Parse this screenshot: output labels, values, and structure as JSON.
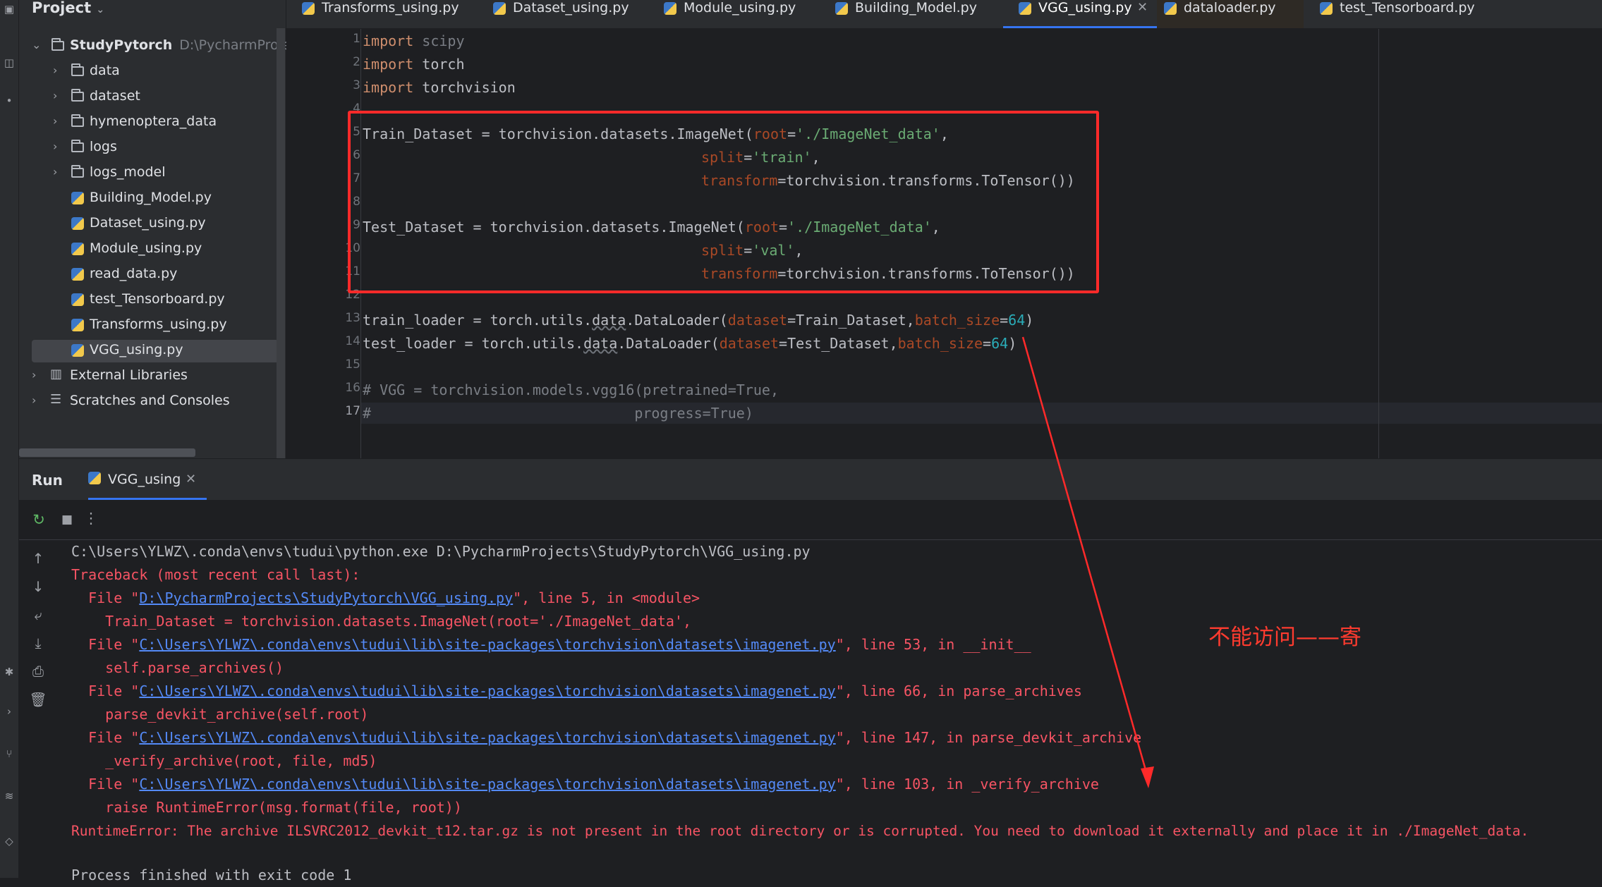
{
  "project": {
    "title": "Project",
    "tree": [
      {
        "label": "StudyPytorch",
        "path": "D:\\PycharmProjects",
        "kind": "folder",
        "level": 0,
        "expanded": true
      },
      {
        "label": "data",
        "kind": "folder",
        "level": 1
      },
      {
        "label": "dataset",
        "kind": "folder",
        "level": 1
      },
      {
        "label": "hymenoptera_data",
        "kind": "folder",
        "level": 1
      },
      {
        "label": "logs",
        "kind": "folder",
        "level": 1
      },
      {
        "label": "logs_model",
        "kind": "folder",
        "level": 1
      },
      {
        "label": "Building_Model.py",
        "kind": "python",
        "level": 1
      },
      {
        "label": "Dataset_using.py",
        "kind": "python",
        "level": 1
      },
      {
        "label": "Module_using.py",
        "kind": "python",
        "level": 1
      },
      {
        "label": "read_data.py",
        "kind": "python",
        "level": 1
      },
      {
        "label": "test_Tensorboard.py",
        "kind": "python",
        "level": 1
      },
      {
        "label": "Transforms_using.py",
        "kind": "python",
        "level": 1
      },
      {
        "label": "VGG_using.py",
        "kind": "python",
        "level": 1,
        "selected": true
      },
      {
        "label": "External Libraries",
        "kind": "library",
        "level": 0
      },
      {
        "label": "Scratches and Consoles",
        "kind": "scratch",
        "level": 0
      }
    ]
  },
  "tabs": [
    {
      "label": "Transforms_using.py"
    },
    {
      "label": "Dataset_using.py"
    },
    {
      "label": "Module_using.py"
    },
    {
      "label": "Building_Model.py"
    },
    {
      "label": "VGG_using.py",
      "active": true
    },
    {
      "label": "dataloader.py"
    },
    {
      "label": "test_Tensorboard.py"
    }
  ],
  "editor": {
    "current_line": 17,
    "line_numbers": [
      "1",
      "2",
      "3",
      "4",
      "5",
      "6",
      "7",
      "8",
      "9",
      "10",
      "11",
      "12",
      "13",
      "14",
      "15",
      "16",
      "17"
    ],
    "code": {
      "l1": {
        "kw": "import",
        "rest": " scipy"
      },
      "l2": {
        "kw": "import",
        "rest": " torch"
      },
      "l3": {
        "kw": "import",
        "rest": " torchvision"
      },
      "l5": {
        "a": "Train_Dataset = torchvision.datasets.ImageNet(",
        "p": "root",
        "eq": "=",
        "s": "'./ImageNet_data'",
        "end": ","
      },
      "l6": {
        "p": "split",
        "eq": "=",
        "s": "'train'",
        "end": ","
      },
      "l7": {
        "p": "transform",
        "rest": "=torchvision.transforms.ToTensor())"
      },
      "l9": {
        "a": "Test_Dataset = torchvision.datasets.ImageNet(",
        "p": "root",
        "eq": "=",
        "s": "'./ImageNet_data'",
        "end": ","
      },
      "l10": {
        "p": "split",
        "eq": "=",
        "s": "'val'",
        "end": ","
      },
      "l11": {
        "p": "transform",
        "rest": "=torchvision.transforms.ToTensor())"
      },
      "l13": {
        "a": "train_loader = torch.utils.",
        "w": "data",
        "b": ".DataLoader(",
        "p1": "dataset",
        "m": "=Train_Dataset,",
        "p2": "batch_size",
        "eq": "=",
        "n": "64",
        "end": ")"
      },
      "l14": {
        "a": "test_loader = torch.utils.",
        "w": "data",
        "b": ".DataLoader(",
        "p1": "dataset",
        "m": "=Test_Dataset,",
        "p2": "batch_size",
        "eq": "=",
        "n": "64",
        "end": ")"
      },
      "l16": "# VGG = torchvision.models.vgg16(pretrained=True,",
      "l17": "#                               progress=True)"
    }
  },
  "run": {
    "title": "Run",
    "tab_label": "VGG_using",
    "console": {
      "cmd": "C:\\Users\\YLWZ\\.conda\\envs\\tudui\\python.exe D:\\PycharmProjects\\StudyPytorch\\VGG_using.py",
      "traceback": "Traceback (most recent call last):",
      "f1_pre": "  File \"",
      "f1_link": "D:\\PycharmProjects\\StudyPytorch\\VGG_using.py",
      "f1_post": "\", line 5, in <module>",
      "c1": "    Train_Dataset = torchvision.datasets.ImageNet(root='./ImageNet_data',",
      "f2_pre": "  File \"",
      "f2_link": "C:\\Users\\YLWZ\\.conda\\envs\\tudui\\lib\\site-packages\\torchvision\\datasets\\imagenet.py",
      "f2_post": "\", line 53, in __init__",
      "c2": "    self.parse_archives()",
      "f3_pre": "  File \"",
      "f3_link": "C:\\Users\\YLWZ\\.conda\\envs\\tudui\\lib\\site-packages\\torchvision\\datasets\\imagenet.py",
      "f3_post": "\", line 66, in parse_archives",
      "c3": "    parse_devkit_archive(self.root)",
      "f4_pre": "  File \"",
      "f4_link": "C:\\Users\\YLWZ\\.conda\\envs\\tudui\\lib\\site-packages\\torchvision\\datasets\\imagenet.py",
      "f4_post": "\", line 147, in parse_devkit_archive",
      "c4": "    _verify_archive(root, file, md5)",
      "f5_pre": "  File \"",
      "f5_link": "C:\\Users\\YLWZ\\.conda\\envs\\tudui\\lib\\site-packages\\torchvision\\datasets\\imagenet.py",
      "f5_post": "\", line 103, in _verify_archive",
      "c5": "    raise RuntimeError(msg.format(file, root))",
      "error": "RuntimeError: The archive ILSVRC2012_devkit_t12.tar.gz is not present in the root directory or is corrupted. You need to download it externally and place it in ./ImageNet_data.",
      "exit": "Process finished with exit code 1"
    }
  },
  "annotation": {
    "text": "不能访问——寄",
    "color": "#ff3b2f"
  },
  "colors": {
    "highlight_box": "#ff2a2a",
    "accent": "#3574f0",
    "error": "#f75464",
    "link": "#548af7"
  }
}
